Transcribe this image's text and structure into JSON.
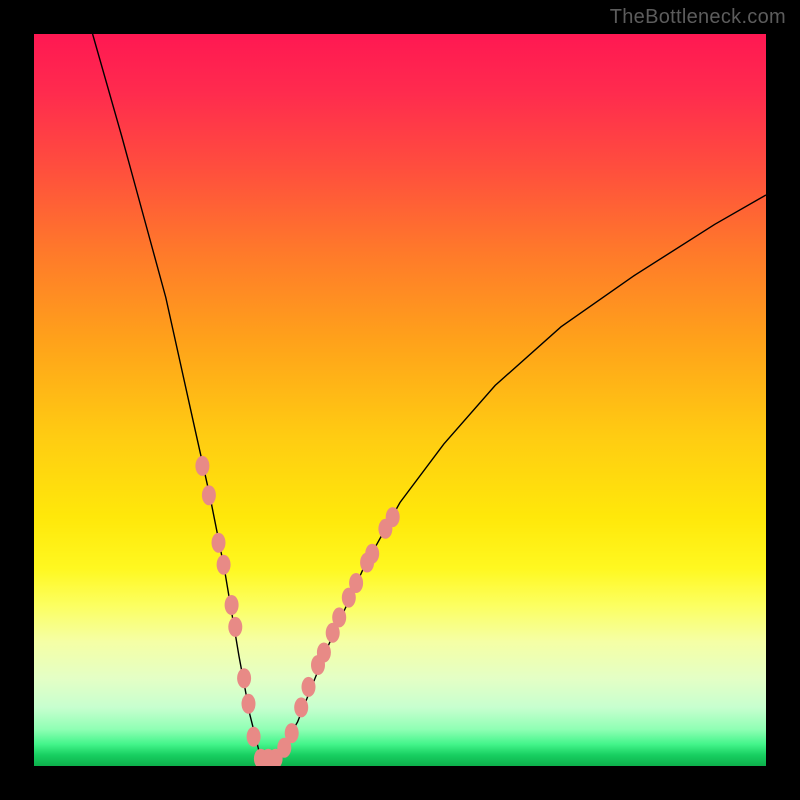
{
  "watermark": "TheBottleneck.com",
  "chart_data": {
    "type": "line",
    "title": "",
    "xlabel": "",
    "ylabel": "",
    "xlim": [
      0,
      100
    ],
    "ylim": [
      0,
      100
    ],
    "series": [
      {
        "name": "bottleneck-curve",
        "x": [
          8,
          12,
          15,
          18,
          20,
          22,
          24,
          26,
          28,
          29.5,
          31,
          33,
          36,
          40,
          45,
          50,
          56,
          63,
          72,
          82,
          93,
          100
        ],
        "y": [
          100,
          86,
          75,
          64,
          55,
          46,
          37,
          27,
          15,
          7,
          1,
          1,
          6,
          16,
          27,
          36,
          44,
          52,
          60,
          67,
          74,
          78
        ]
      }
    ],
    "markers": {
      "name": "highlight-dots",
      "color": "#e88a86",
      "points": [
        {
          "x": 23.0,
          "y": 41.0
        },
        {
          "x": 23.9,
          "y": 37.0
        },
        {
          "x": 25.2,
          "y": 30.5
        },
        {
          "x": 25.9,
          "y": 27.5
        },
        {
          "x": 27.0,
          "y": 22.0
        },
        {
          "x": 27.5,
          "y": 19.0
        },
        {
          "x": 28.7,
          "y": 12.0
        },
        {
          "x": 29.3,
          "y": 8.5
        },
        {
          "x": 30.0,
          "y": 4.0
        },
        {
          "x": 31.0,
          "y": 1.0
        },
        {
          "x": 32.0,
          "y": 1.0
        },
        {
          "x": 33.0,
          "y": 1.0
        },
        {
          "x": 34.2,
          "y": 2.5
        },
        {
          "x": 35.2,
          "y": 4.5
        },
        {
          "x": 36.5,
          "y": 8.0
        },
        {
          "x": 37.5,
          "y": 10.8
        },
        {
          "x": 38.8,
          "y": 13.8
        },
        {
          "x": 39.6,
          "y": 15.5
        },
        {
          "x": 40.8,
          "y": 18.2
        },
        {
          "x": 41.7,
          "y": 20.3
        },
        {
          "x": 43.0,
          "y": 23.0
        },
        {
          "x": 44.0,
          "y": 25.0
        },
        {
          "x": 45.5,
          "y": 27.8
        },
        {
          "x": 46.2,
          "y": 29.0
        },
        {
          "x": 48.0,
          "y": 32.4
        },
        {
          "x": 49.0,
          "y": 34.0
        }
      ]
    },
    "gradient_stops": [
      {
        "pct": 0,
        "color": "#ff1852"
      },
      {
        "pct": 8,
        "color": "#ff2b4e"
      },
      {
        "pct": 18,
        "color": "#ff4d3e"
      },
      {
        "pct": 30,
        "color": "#ff7a2a"
      },
      {
        "pct": 42,
        "color": "#ffa21a"
      },
      {
        "pct": 55,
        "color": "#ffcc12"
      },
      {
        "pct": 66,
        "color": "#ffe80a"
      },
      {
        "pct": 73,
        "color": "#fff820"
      },
      {
        "pct": 78,
        "color": "#fcff60"
      },
      {
        "pct": 83,
        "color": "#f5ffa5"
      },
      {
        "pct": 88,
        "color": "#e4ffc5"
      },
      {
        "pct": 92,
        "color": "#c7ffcf"
      },
      {
        "pct": 95,
        "color": "#8fffb4"
      },
      {
        "pct": 97,
        "color": "#44f58b"
      },
      {
        "pct": 98.5,
        "color": "#18cf61"
      },
      {
        "pct": 100,
        "color": "#0db04b"
      }
    ]
  }
}
